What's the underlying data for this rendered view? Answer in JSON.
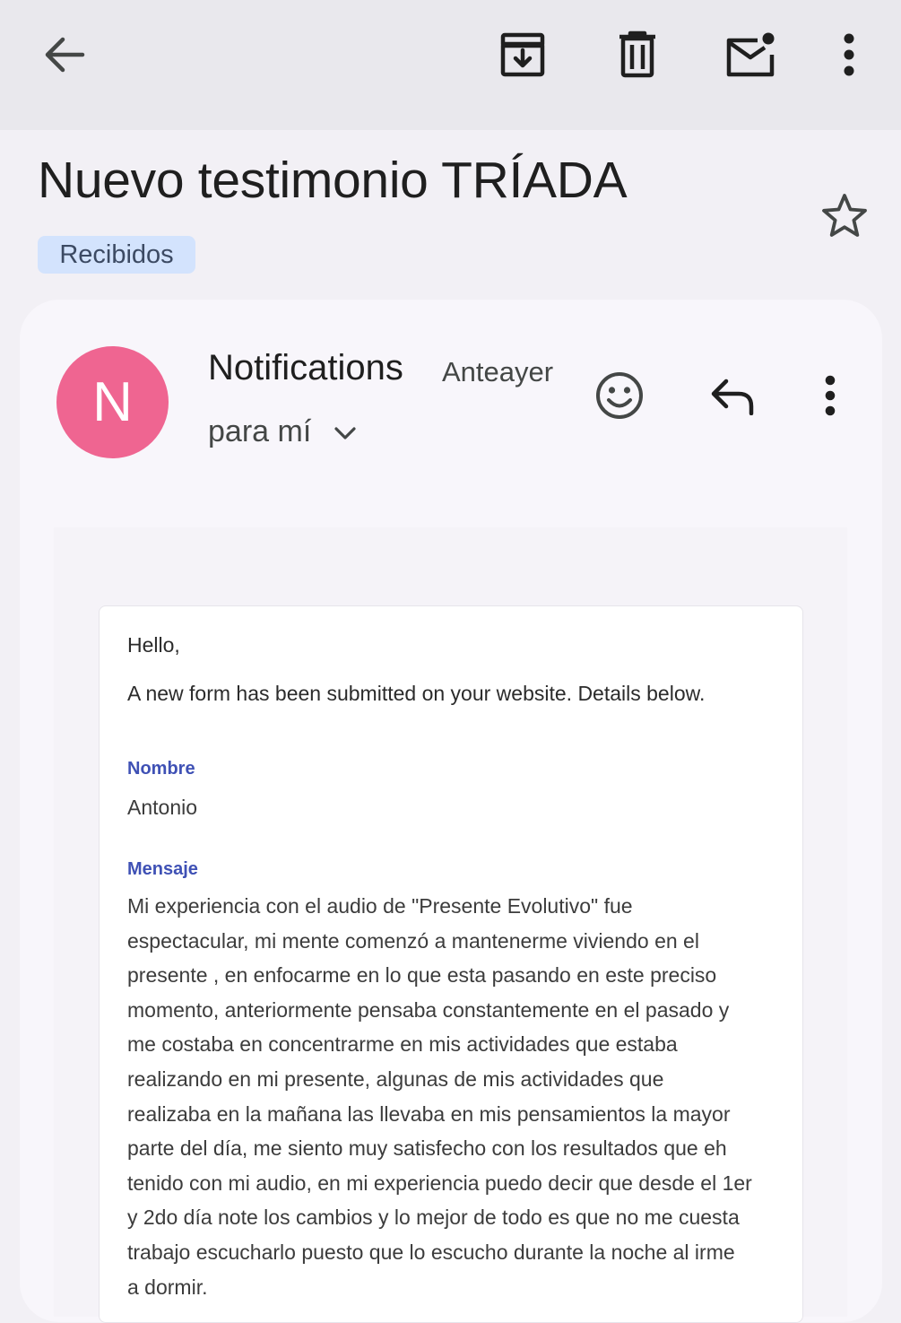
{
  "toolbar": {
    "back_icon": "arrow-left-icon",
    "archive_icon": "archive-icon",
    "delete_icon": "trash-icon",
    "mark_unread_icon": "mark-unread-icon",
    "more_icon": "more-vert-icon"
  },
  "subject": "Nuevo testimonio TRÍADA",
  "label": "Recibidos",
  "message_header": {
    "avatar_letter": "N",
    "avatar_color": "#ef6591",
    "sender": "Notifications",
    "date": "Anteayer",
    "recipient": "para mí"
  },
  "email": {
    "greeting": "Hello,",
    "intro": "A new form has been submitted on your website. Details below.",
    "fields": [
      {
        "label": "Nombre",
        "value": "Antonio"
      },
      {
        "label": "Mensaje",
        "lines": [
          "Mi experiencia con el audio de \"Presente Evolutivo\" fue",
          "espectacular, mi mente comenzó a mantenerme viviendo en el",
          "presente , en enfocarme en lo que esta pasando en este preciso",
          "momento, anteriormente pensaba constantemente en el pasado y",
          "me costaba en concentrarme en mis actividades que estaba",
          "realizando en mi presente, algunas de mis actividades que",
          "realizaba en la mañana las llevaba en mis pensamientos la mayor",
          "parte del día, me siento muy satisfecho con los resultados que eh",
          "tenido con mi audio, en mi experiencia puedo decir que desde el 1er",
          "y 2do día note los cambios y lo mejor de todo es que no me cuesta",
          "trabajo escucharlo puesto que lo escucho durante la noche al irme",
          "a dormir."
        ]
      }
    ]
  },
  "colors": {
    "label_link": "#3f51b5",
    "chip_bg": "#d3e3fd"
  }
}
